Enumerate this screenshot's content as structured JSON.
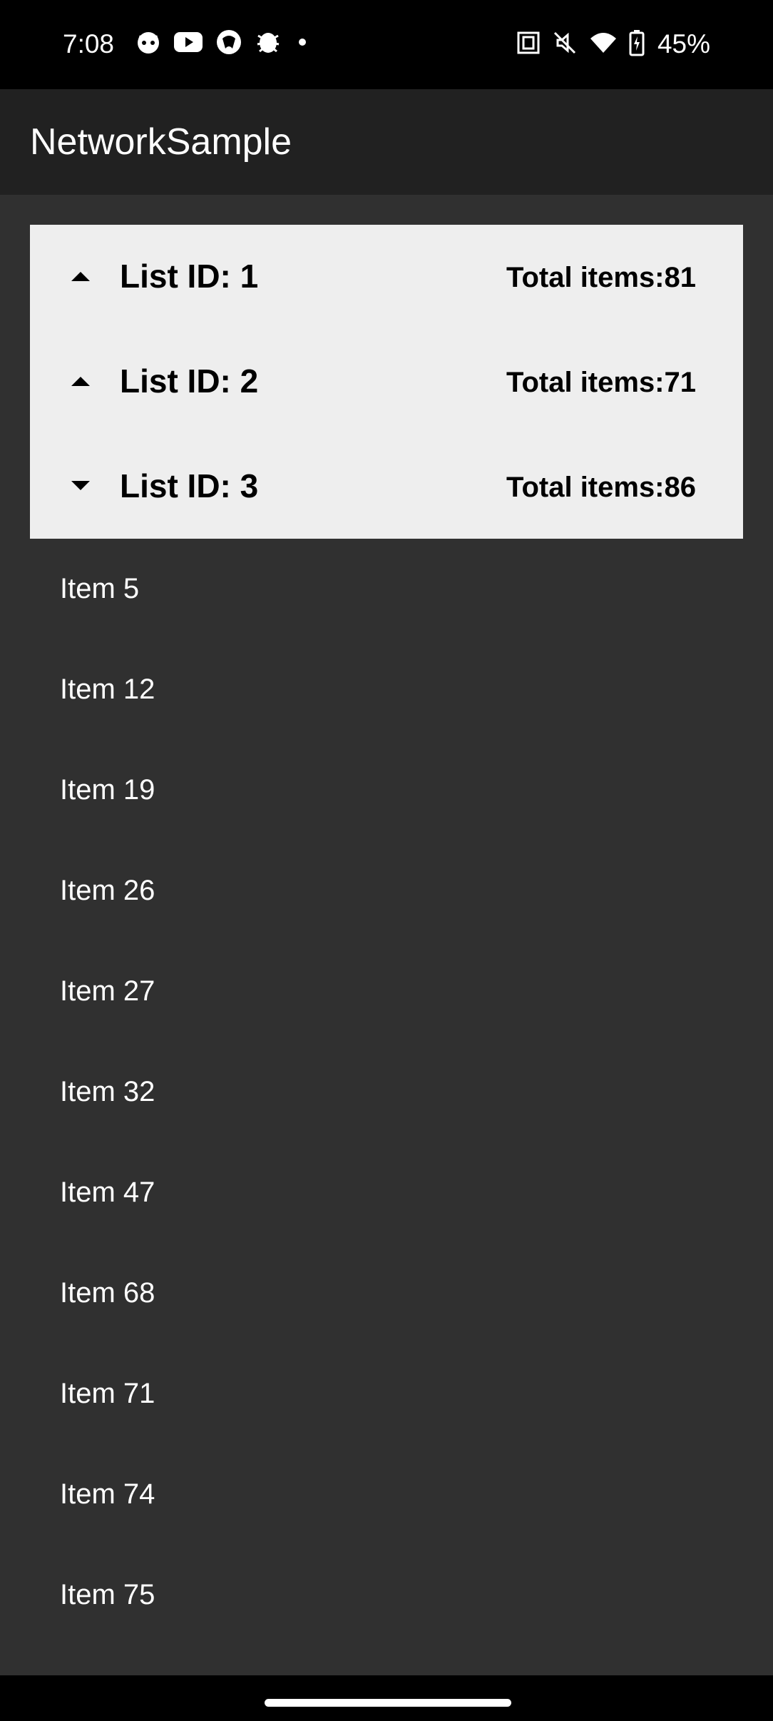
{
  "status_bar": {
    "time": "7:08",
    "left_icons": [
      "cat-icon",
      "youtube-icon",
      "browser-icon",
      "bug-icon",
      "dot-icon"
    ],
    "right_icons": [
      "nfc-icon",
      "mute-icon",
      "wifi-icon",
      "battery-charging-icon"
    ],
    "battery": "45%"
  },
  "app_bar": {
    "title": "NetworkSample"
  },
  "groups": [
    {
      "title": "List ID: 1",
      "total": "Total items:81",
      "expanded": false
    },
    {
      "title": "List ID: 2",
      "total": "Total items:71",
      "expanded": false
    },
    {
      "title": "List ID: 3",
      "total": "Total items:86",
      "expanded": true
    }
  ],
  "items": [
    "Item 5",
    "Item 12",
    "Item 19",
    "Item 26",
    "Item 27",
    "Item 32",
    "Item 47",
    "Item 68",
    "Item 71",
    "Item 74",
    "Item 75"
  ],
  "colors": {
    "background": "#303030",
    "app_bar": "#212121",
    "group_panel": "#eeeeee",
    "status_bar": "#000000"
  }
}
